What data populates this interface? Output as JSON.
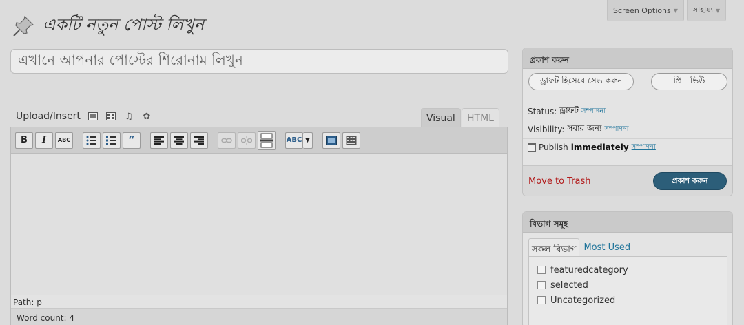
{
  "screen_tabs": {
    "screen_options": "Screen Options",
    "help": "সাহায্য"
  },
  "page_title": "একটি নতুন পোস্ট লিখুন",
  "title_input": {
    "placeholder": "এখানে আপনার পোস্টের শিরোনাম লিখুন"
  },
  "upload": {
    "label": "Upload/Insert",
    "icons": [
      "image-icon",
      "video-icon",
      "audio-icon",
      "media-icon"
    ]
  },
  "editor": {
    "tabs": [
      "Visual",
      "HTML"
    ],
    "active_tab": "Visual",
    "toolbar": [
      "bold",
      "italic",
      "strikethrough",
      "bullet-list",
      "numbered-list",
      "blockquote",
      "align-left",
      "align-center",
      "align-right",
      "insert-link",
      "unlink",
      "insert-more",
      "spellcheck",
      "fullscreen",
      "kitchen-sink"
    ],
    "path": "Path: p",
    "word_count": "Word count: 4"
  },
  "publish": {
    "title": "প্রকাশ করুন",
    "save_draft": "ড্রাফট হিসেবে সেভ করুন",
    "preview": "প্রি - ভিউ",
    "status_label": "Status:",
    "status_value": "ড্রাফট",
    "visibility_label": "Visibility:",
    "visibility_value": "সবার জন্য",
    "publish_label": "Publish",
    "publish_value": "immediately",
    "edit_link": "সম্পাদনা",
    "trash": "Move to Trash",
    "publish_button": "প্রকাশ করুন"
  },
  "categories": {
    "title": "বিভাগ সমূহ",
    "tab_all": "সকল বিভাগ",
    "tab_most_used": "Most Used",
    "items": [
      "featuredcategory",
      "selected",
      "Uncategorized"
    ]
  },
  "colors": {
    "background": "#dcdcdc",
    "link": "#21759b",
    "trash": "#b21b1b",
    "primary_button": "#2c5e79"
  }
}
